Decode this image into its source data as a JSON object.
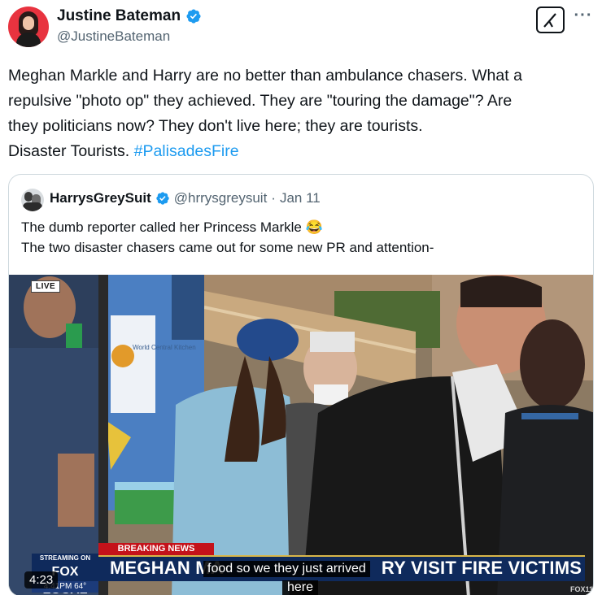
{
  "author": {
    "display_name": "Justine Bateman",
    "handle": "@JustineBateman",
    "verified": true
  },
  "tweet": {
    "text_lines": [
      "Meghan Markle and Harry are no better than ambulance chasers. What a",
      "repulsive \"photo op\" they achieved. They are \"touring the damage\"? Are",
      "they politicians now? They don't live here; they are tourists.",
      "Disaster Tourists. "
    ],
    "hashtag": "#PalisadesFire"
  },
  "quote": {
    "display_name": "HarrysGreySuit",
    "handle": "@hrrysgreysuit",
    "separator": "·",
    "date": "Jan 11",
    "line1": "The dumb reporter called her Princess Markle 😂",
    "line2": "The two disaster chasers came out for some new PR and attention-"
  },
  "video": {
    "live_badge": "LIVE",
    "truck_text": "World Central Kitchen",
    "breaking_label": "BREAKING NEWS",
    "streaming_label": "STREAMING ON",
    "channel_logo": "FOX LOCAL",
    "clock": "4:41PM",
    "temperature": "64°",
    "headline_start": "MEGHAN MA",
    "headline_end": "RY VISIT FIRE VICTIMS",
    "caption_line1": "food so we they just arrived",
    "caption_line2": "here",
    "duration": "4:23",
    "corner_bug": "FOX11"
  },
  "icons": {
    "verified": "verified-badge-icon",
    "grok": "grok-icon",
    "more": "more-options-icon"
  },
  "colors": {
    "accent": "#1d9bf0",
    "secondary_text": "#536471",
    "breaking_red": "#c4121a",
    "news_navy": "#0f2a5c"
  }
}
